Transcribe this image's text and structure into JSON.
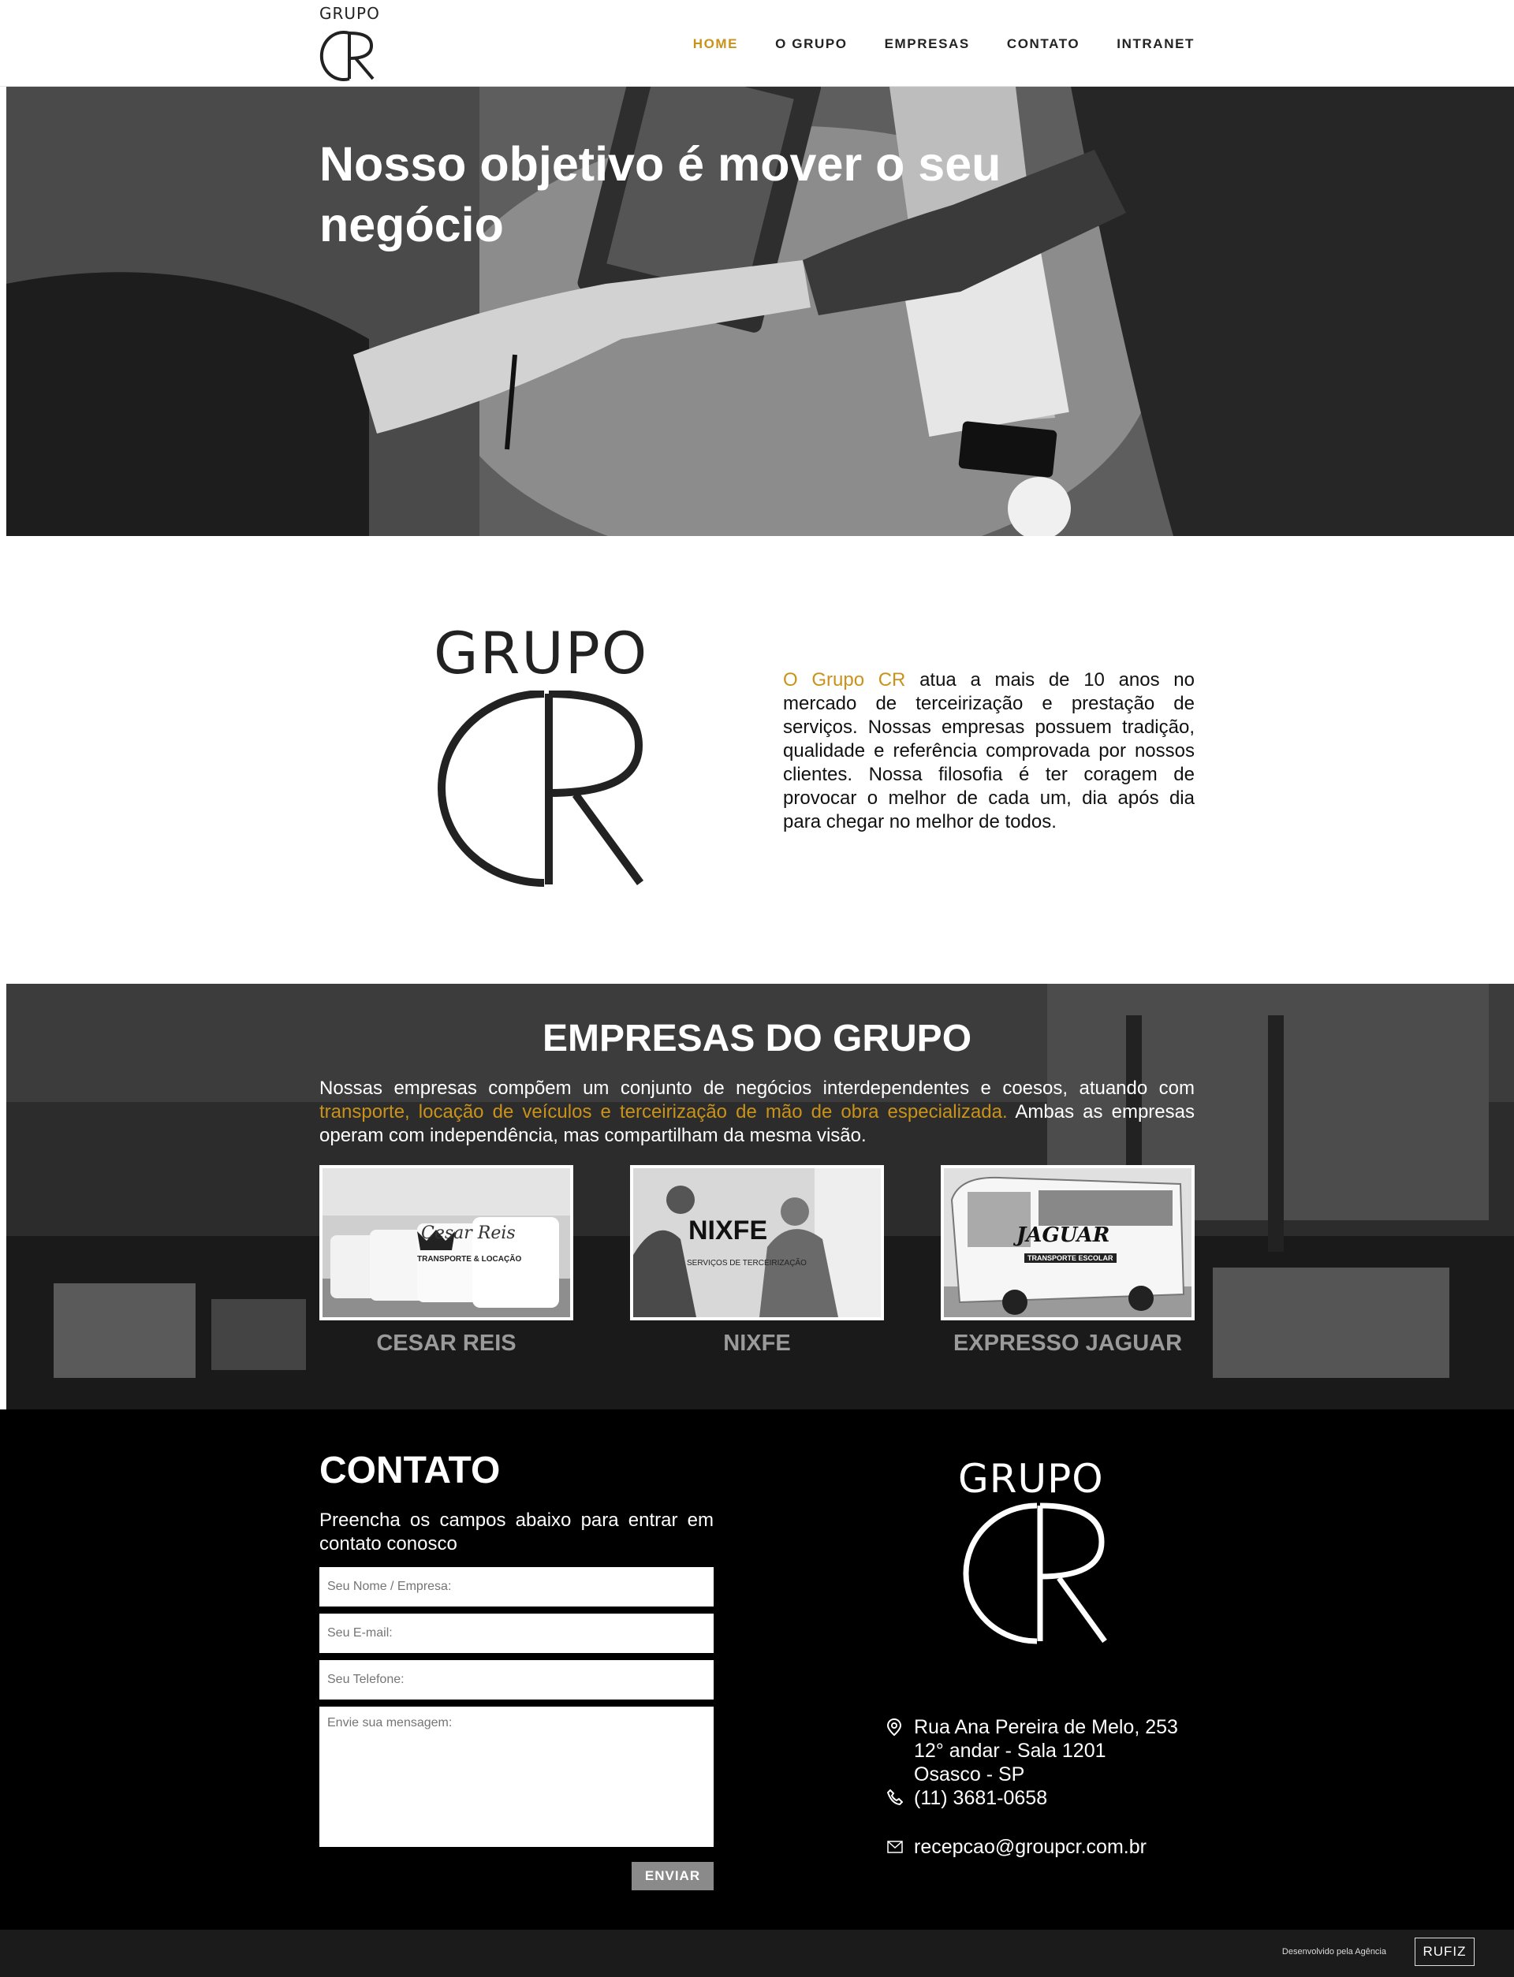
{
  "header": {
    "logo_top": "GRUPO",
    "nav": [
      "HOME",
      "O GRUPO",
      "EMPRESAS",
      "CONTATO",
      "INTRANET"
    ]
  },
  "hero": {
    "title": "Nosso objetivo é mover o seu negócio"
  },
  "about": {
    "logo_top": "GRUPO",
    "highlight": "O Grupo CR",
    "text": " atua a mais de 10 anos no mercado de terceirização e prestação de serviços. Nossas empresas possuem tradição, qualidade e referência comprovada por nossos clientes. Nossa filosofia é ter coragem de provocar o melhor de cada um, dia após dia para chegar no melhor de todos."
  },
  "empresas": {
    "title": "EMPRESAS DO GRUPO",
    "desc_start": "Nossas empresas compõem um conjunto de negócios interdependentes e coesos, atuando com ",
    "desc_highlight": "transporte, locação de veículos e terceirização de mão de obra especializada.",
    "desc_end": " Ambas as empresas operam com independência, mas compartilham da mesma visão.",
    "companies": [
      {
        "name": "CESAR REIS",
        "logo": "Cesar Reis",
        "tagline": "TRANSPORTE & LOCAÇÃO"
      },
      {
        "name": "NIXFE",
        "logo": "NIXFE",
        "tagline": "SERVIÇOS DE TERCEIRIZAÇÃO"
      },
      {
        "name": "EXPRESSO JAGUAR",
        "logo": "JAGUAR",
        "tagline": "TRANSPORTE ESCOLAR"
      }
    ]
  },
  "contato": {
    "title": "CONTATO",
    "subtitle": "Preencha os campos abaixo para entrar em contato conosco",
    "placeholders": {
      "name": "Seu Nome / Empresa:",
      "email": "Seu E-mail:",
      "phone": "Seu Telefone:",
      "message": "Envie sua mensagem:"
    },
    "send_label": "ENVIAR",
    "logo_top": "GRUPO",
    "address_lines": [
      "Rua Ana Pereira de Melo, 253",
      "12° andar - Sala 1201",
      "Osasco - SP"
    ],
    "phone": "(11) 3681-0658",
    "email": "recepcao@groupcr.com.br"
  },
  "footer": {
    "credit": "Desenvolvido pela Agência",
    "agency": "RUFIZ"
  },
  "colors": {
    "accent": "#c9921a"
  }
}
